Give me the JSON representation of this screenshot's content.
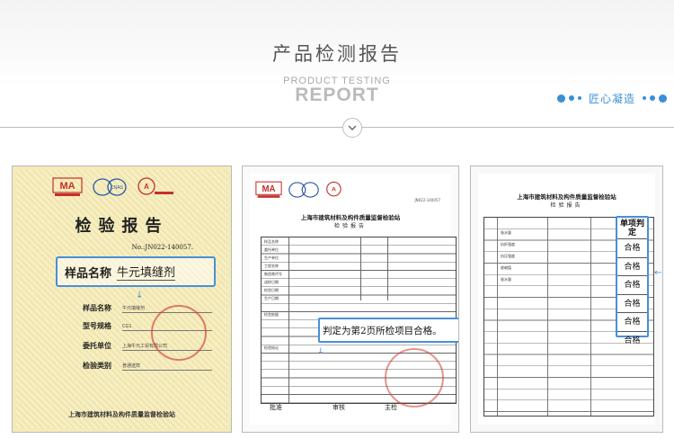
{
  "header": {
    "title_cn": "产品检测报告",
    "subtitle_en": "PRODUCT TESTING",
    "title_en": "REPORT",
    "slogan": "匠心凝造"
  },
  "colors": {
    "accent_blue": "#3a8fd6",
    "divider_gray": "#bdbdbd",
    "cert_yellow": "#f4ebb8",
    "seal_red": "#d23c32"
  },
  "logos": [
    "MA",
    "CNAS",
    "CAL"
  ],
  "certificate": {
    "title": "检验报告",
    "report_no": "No.:JN022-140057.",
    "sample_name_label": "样品名称",
    "sample_name_value": "牛元填缝剂",
    "rows": [
      {
        "label": "样品名称",
        "value": "牛元填缝剂"
      },
      {
        "label": "型号规格",
        "value": "CG1"
      },
      {
        "label": "委托单位",
        "value": "上海牛元工贸有限公司"
      },
      {
        "label": "检验类别",
        "value": "普通送样"
      }
    ],
    "footer": "上海市建筑材料及构件质量监督检验站"
  },
  "report_page1": {
    "header": "上海市建筑材料及构件质量监督检验站",
    "subheader": "检验报告",
    "number": "JN022-140057",
    "highlight": "判定为第2页所检项目合格。",
    "fields": [
      "样品名称",
      "委托单位",
      "生产单位",
      "工程名称",
      "制造商代号",
      "送样日期",
      "检验日期",
      "生产日期",
      "检验依据",
      "检验结论"
    ],
    "signatures": [
      "批准",
      "审核",
      "主检"
    ]
  },
  "report_page2": {
    "header": "上海市建筑材料及构件质量监督检验站",
    "subheader": "检验报告",
    "judgement_header": "单项判定",
    "judgements": [
      "合格",
      "合格",
      "合格",
      "合格",
      "合格",
      "合格"
    ],
    "items": [
      "吸水量",
      "抗折强度",
      "抗压强度",
      "收缩值",
      "吸水量"
    ]
  }
}
